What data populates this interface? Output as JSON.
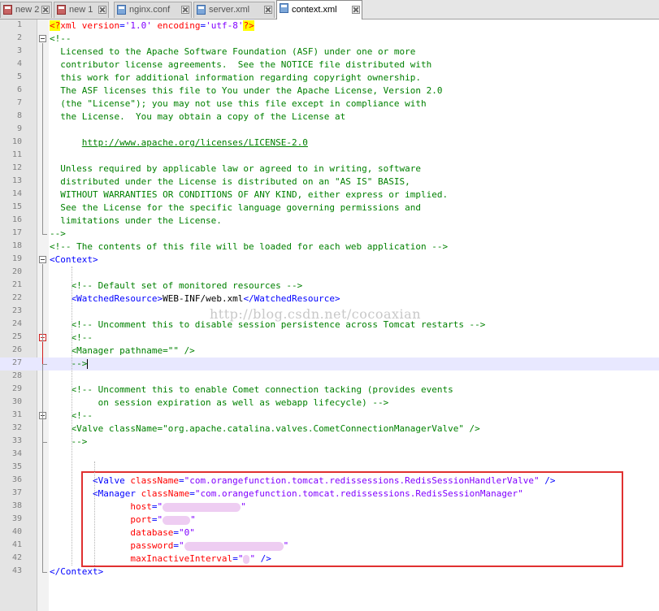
{
  "tabs": [
    {
      "label": "new 2",
      "icon": "document-icon",
      "modified": true,
      "active": false
    },
    {
      "label": "new 1",
      "icon": "document-icon",
      "modified": true,
      "active": false
    },
    {
      "label": "nginx.conf",
      "icon": "document-icon",
      "modified": false,
      "active": false
    },
    {
      "label": "server.xml",
      "icon": "document-icon",
      "modified": false,
      "active": false
    },
    {
      "label": "context.xml",
      "icon": "document-icon",
      "modified": false,
      "active": true
    }
  ],
  "editor": {
    "current_line": 27,
    "watermark": "http://blog.csdn.net/cocoaxian",
    "lines": [
      {
        "n": "1",
        "segs": [
          [
            "pi",
            "<?"
          ],
          [
            "decl",
            "xml "
          ],
          [
            "attr",
            "version"
          ],
          [
            "tag",
            "="
          ],
          [
            "val",
            "'1.0'"
          ],
          [
            "text",
            " "
          ],
          [
            "attr",
            "encoding"
          ],
          [
            "tag",
            "="
          ],
          [
            "val",
            "'utf-8'"
          ],
          [
            "pi",
            "?>"
          ]
        ]
      },
      {
        "n": "2",
        "segs": [
          [
            "comment",
            "<!--"
          ]
        ]
      },
      {
        "n": "3",
        "segs": [
          [
            "comment",
            "  Licensed to the Apache Software Foundation (ASF) under one or more"
          ]
        ]
      },
      {
        "n": "4",
        "segs": [
          [
            "comment",
            "  contributor license agreements.  See the NOTICE file distributed with"
          ]
        ]
      },
      {
        "n": "5",
        "segs": [
          [
            "comment",
            "  this work for additional information regarding copyright ownership."
          ]
        ]
      },
      {
        "n": "6",
        "segs": [
          [
            "comment",
            "  The ASF licenses this file to You under the Apache License, Version 2.0"
          ]
        ]
      },
      {
        "n": "7",
        "segs": [
          [
            "comment",
            "  (the \"License\"); you may not use this file except in compliance with"
          ]
        ]
      },
      {
        "n": "8",
        "segs": [
          [
            "comment",
            "  the License.  You may obtain a copy of the License at"
          ]
        ]
      },
      {
        "n": "9",
        "segs": []
      },
      {
        "n": "10",
        "segs": [
          [
            "comment",
            "      "
          ],
          [
            "link",
            "http://www.apache.org/licenses/LICENSE-2.0"
          ]
        ]
      },
      {
        "n": "11",
        "segs": []
      },
      {
        "n": "12",
        "segs": [
          [
            "comment",
            "  Unless required by applicable law or agreed to in writing, software"
          ]
        ]
      },
      {
        "n": "13",
        "segs": [
          [
            "comment",
            "  distributed under the License is distributed on an \"AS IS\" BASIS,"
          ]
        ]
      },
      {
        "n": "14",
        "segs": [
          [
            "comment",
            "  WITHOUT WARRANTIES OR CONDITIONS OF ANY KIND, either express or implied."
          ]
        ]
      },
      {
        "n": "15",
        "segs": [
          [
            "comment",
            "  See the License for the specific language governing permissions and"
          ]
        ]
      },
      {
        "n": "16",
        "segs": [
          [
            "comment",
            "  limitations under the License."
          ]
        ]
      },
      {
        "n": "17",
        "segs": [
          [
            "comment",
            "-->"
          ]
        ]
      },
      {
        "n": "18",
        "segs": [
          [
            "comment",
            "<!-- The contents of this file will be loaded for each web application -->"
          ]
        ]
      },
      {
        "n": "19",
        "segs": [
          [
            "tag",
            "<Context>"
          ]
        ]
      },
      {
        "n": "20",
        "segs": []
      },
      {
        "n": "21",
        "segs": [
          [
            "comment",
            "    <!-- Default set of monitored resources -->"
          ]
        ]
      },
      {
        "n": "22",
        "segs": [
          [
            "text",
            "    "
          ],
          [
            "tag",
            "<WatchedResource>"
          ],
          [
            "text",
            "WEB-INF/web.xml"
          ],
          [
            "tag",
            "</WatchedResource>"
          ]
        ]
      },
      {
        "n": "23",
        "segs": []
      },
      {
        "n": "24",
        "segs": [
          [
            "comment",
            "    <!-- Uncomment this to disable session persistence across Tomcat restarts -->"
          ]
        ]
      },
      {
        "n": "25",
        "segs": [
          [
            "comment",
            "    <!--"
          ]
        ]
      },
      {
        "n": "26",
        "segs": [
          [
            "comment",
            "    <Manager pathname=\"\" />"
          ]
        ]
      },
      {
        "n": "27",
        "segs": [
          [
            "comment",
            "    -->"
          ],
          [
            "cursor",
            ""
          ]
        ]
      },
      {
        "n": "28",
        "segs": []
      },
      {
        "n": "29",
        "segs": [
          [
            "comment",
            "    <!-- Uncomment this to enable Comet connection tacking (provides events"
          ]
        ]
      },
      {
        "n": "30",
        "segs": [
          [
            "comment",
            "         on session expiration as well as webapp lifecycle) -->"
          ]
        ]
      },
      {
        "n": "31",
        "segs": [
          [
            "comment",
            "    <!--"
          ]
        ]
      },
      {
        "n": "32",
        "segs": [
          [
            "comment",
            "    <Valve className=\"org.apache.catalina.valves.CometConnectionManagerValve\" />"
          ]
        ]
      },
      {
        "n": "33",
        "segs": [
          [
            "comment",
            "    -->"
          ]
        ]
      },
      {
        "n": "34",
        "segs": []
      },
      {
        "n": "35",
        "segs": []
      },
      {
        "n": "36",
        "segs": [
          [
            "text",
            "        "
          ],
          [
            "tag",
            "<Valve "
          ],
          [
            "attr",
            "className"
          ],
          [
            "tag",
            "="
          ],
          [
            "val",
            "\"com.orangefunction.tomcat.redissessions.RedisSessionHandlerValve\""
          ],
          [
            "tag",
            " />"
          ]
        ]
      },
      {
        "n": "37",
        "segs": [
          [
            "text",
            "        "
          ],
          [
            "tag",
            "<Manager "
          ],
          [
            "attr",
            "className"
          ],
          [
            "tag",
            "="
          ],
          [
            "val",
            "\"com.orangefunction.tomcat.redissessions.RedisSessionManager\""
          ]
        ]
      },
      {
        "n": "38",
        "segs": [
          [
            "text",
            "               "
          ],
          [
            "attr",
            "host"
          ],
          [
            "tag",
            "="
          ],
          [
            "val",
            "\""
          ],
          [
            "blur",
            "96"
          ],
          [
            "val",
            "\""
          ]
        ]
      },
      {
        "n": "39",
        "segs": [
          [
            "text",
            "               "
          ],
          [
            "attr",
            "port"
          ],
          [
            "tag",
            "="
          ],
          [
            "val",
            "\""
          ],
          [
            "blur",
            "34"
          ],
          [
            "val",
            "\""
          ]
        ]
      },
      {
        "n": "40",
        "segs": [
          [
            "text",
            "               "
          ],
          [
            "attr",
            "database"
          ],
          [
            "tag",
            "="
          ],
          [
            "val",
            "\"0\""
          ]
        ]
      },
      {
        "n": "41",
        "segs": [
          [
            "text",
            "               "
          ],
          [
            "attr",
            "password"
          ],
          [
            "tag",
            "="
          ],
          [
            "val",
            "\""
          ],
          [
            "blur",
            "122"
          ],
          [
            "val",
            "\""
          ]
        ]
      },
      {
        "n": "42",
        "segs": [
          [
            "text",
            "               "
          ],
          [
            "attr",
            "maxInactiveInterval"
          ],
          [
            "tag",
            "="
          ],
          [
            "val",
            "\""
          ],
          [
            "blur",
            "8"
          ],
          [
            "val",
            "\""
          ],
          [
            "tag",
            " />"
          ]
        ]
      },
      {
        "n": "43",
        "segs": [
          [
            "tag",
            "</Context>"
          ]
        ]
      }
    ]
  }
}
